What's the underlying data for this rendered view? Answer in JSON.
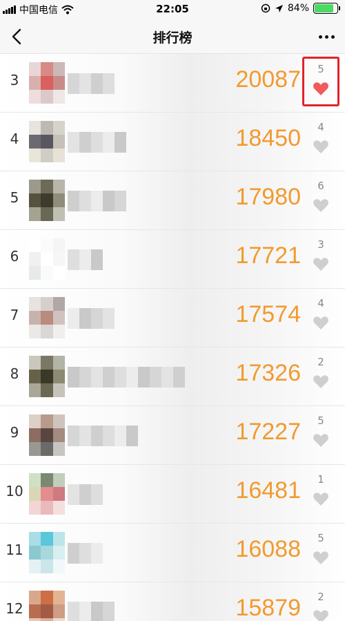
{
  "status_bar": {
    "carrier": "中国电信",
    "time": "22:05",
    "battery_percent": "84%",
    "battery_level": 0.84
  },
  "nav": {
    "title": "排行榜"
  },
  "colors": {
    "score": "#f29a2e",
    "heart_active": "#f25b5b",
    "heart_inactive": "#cfcfcf",
    "highlight_border": "#e0232a"
  },
  "rows": [
    {
      "rank": "3",
      "score": "20087",
      "likes": "5",
      "liked": true
    },
    {
      "rank": "4",
      "score": "18450",
      "likes": "4",
      "liked": false
    },
    {
      "rank": "5",
      "score": "17980",
      "likes": "6",
      "liked": false
    },
    {
      "rank": "6",
      "score": "17721",
      "likes": "3",
      "liked": false
    },
    {
      "rank": "7",
      "score": "17574",
      "likes": "4",
      "liked": false
    },
    {
      "rank": "8",
      "score": "17326",
      "likes": "2",
      "liked": false
    },
    {
      "rank": "9",
      "score": "17227",
      "likes": "5",
      "liked": false
    },
    {
      "rank": "10",
      "score": "16481",
      "likes": "1",
      "liked": false
    },
    {
      "rank": "11",
      "score": "16088",
      "likes": "5",
      "liked": false
    },
    {
      "rank": "12",
      "score": "15879",
      "likes": "2",
      "liked": false
    }
  ]
}
